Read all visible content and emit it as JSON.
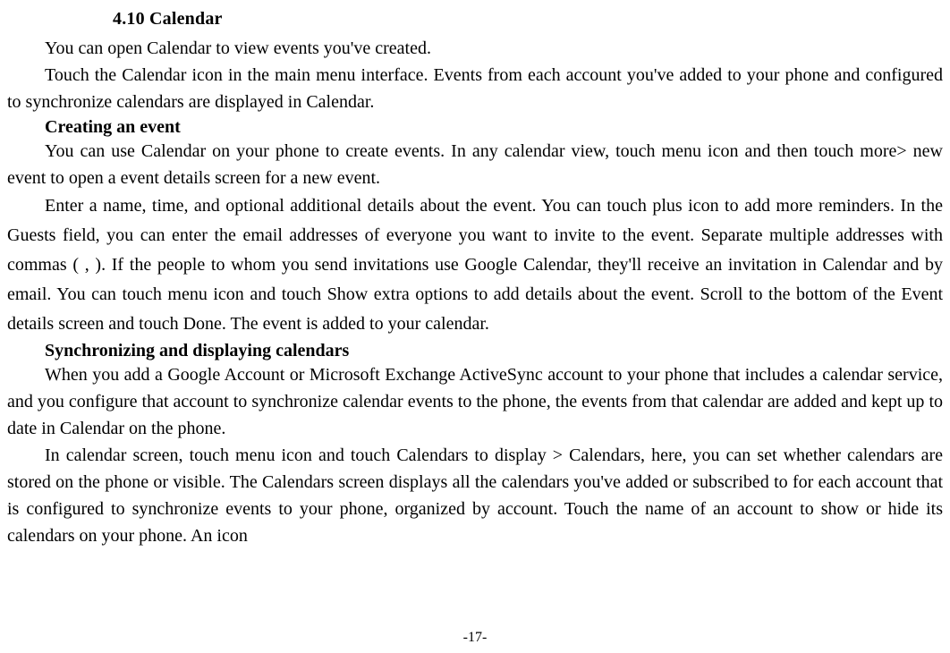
{
  "heading": "4.10   Calendar",
  "p1": "You can open Calendar to view events you've created.",
  "p2": "Touch the Calendar icon in the main menu interface. Events from each account you've added to your phone and configured to synchronize calendars are displayed in Calendar.",
  "h_creating": "Creating an event",
  "p3": "You can use Calendar on your phone to create events. In any calendar view, touch menu icon and then touch more> new event to open a event details screen for a new event.",
  "p4": "Enter a name, time, and optional additional details about the event. You can touch plus icon to add more reminders. In the Guests field, you can enter the email addresses of everyone you want to invite to the event. Separate multiple addresses with commas ( , ). If the people to whom you send invitations use Google Calendar, they'll receive an invitation in Calendar and by email. You can touch menu icon and touch Show extra options to add details about the event. Scroll to the bottom of the Event details screen and touch Done. The event is added to your calendar.",
  "h_sync": "Synchronizing and displaying calendars",
  "p5": "When you add a Google Account or Microsoft Exchange ActiveSync account to your phone that includes a calendar service, and you configure that account to synchronize calendar events to the phone, the events from that calendar are added and kept up to date in Calendar on the phone.",
  "p6": "In calendar screen, touch menu icon and touch Calendars to display > Calendars, here, you can set whether calendars are stored on the phone or visible. The Calendars screen displays all the calendars you've added or subscribed to for each account that is configured to synchronize events to your phone, organized by account. Touch the name of an account to show or hide its calendars on your phone. An icon",
  "page_number": "-17-"
}
